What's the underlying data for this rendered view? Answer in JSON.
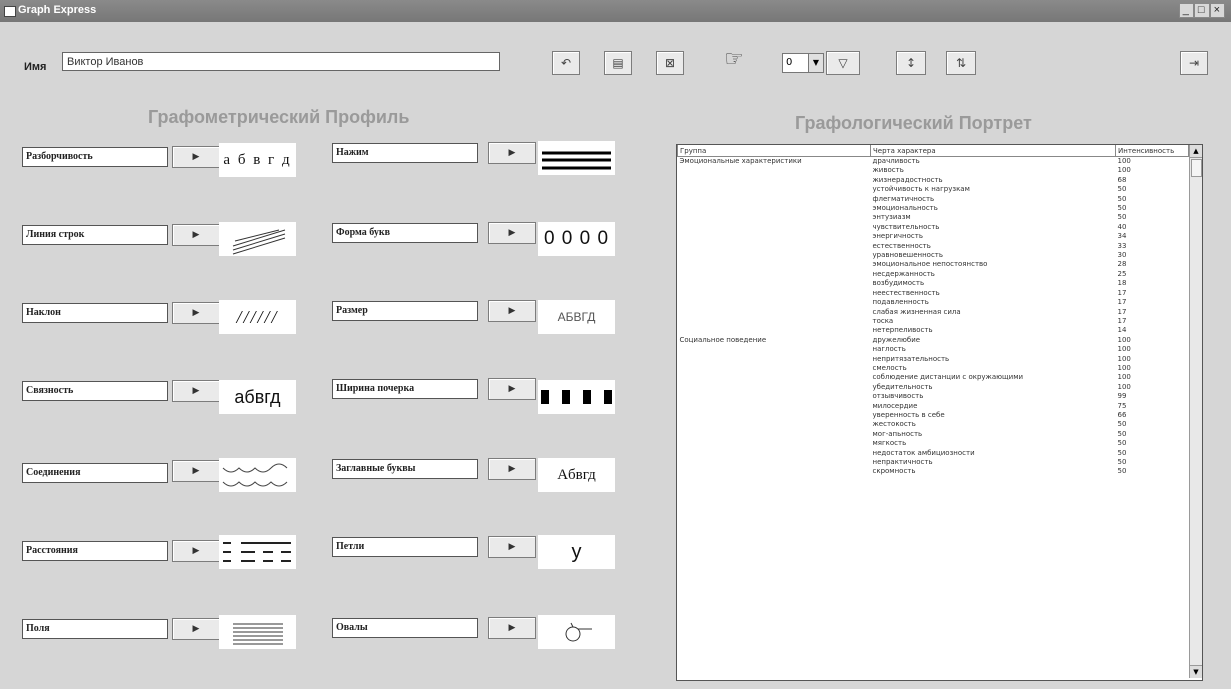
{
  "window": {
    "title": "Graph Express",
    "controls": [
      "_",
      "□",
      "×"
    ]
  },
  "name_label": "Имя",
  "name_value": "Виктор Иванов",
  "toolbar": {
    "combo_value": "0"
  },
  "left_heading": "Графометрический Профиль",
  "right_heading": "Графологический Портрет",
  "profile_items": [
    {
      "label": "Разборчивость",
      "sample": "а б в г д"
    },
    {
      "label": "Нажим",
      "sample": ""
    },
    {
      "label": "Линия строк",
      "sample": ""
    },
    {
      "label": "Форма букв",
      "sample": "0 0 0 0"
    },
    {
      "label": "Наклон",
      "sample": "//////"
    },
    {
      "label": "Размер",
      "sample": "АБВГД"
    },
    {
      "label": "Связность",
      "sample": "абвгд"
    },
    {
      "label": "Ширина почерка",
      "sample": ""
    },
    {
      "label": "Соединения",
      "sample": ""
    },
    {
      "label": "Заглавные буквы",
      "sample": "Aбвгд"
    },
    {
      "label": "Расстояния",
      "sample": ""
    },
    {
      "label": "Петли",
      "sample": "у"
    },
    {
      "label": "Поля",
      "sample": ""
    },
    {
      "label": "Овалы",
      "sample": ""
    }
  ],
  "table": {
    "headers": [
      "Группа",
      "Черта характера",
      "Интенсивность"
    ],
    "rows": [
      [
        "Эмоциональные характеристики",
        "драчливость",
        "100"
      ],
      [
        "",
        "живость",
        "100"
      ],
      [
        "",
        "жизнерадостность",
        "68"
      ],
      [
        "",
        "устойчивость к нагрузкам",
        "50"
      ],
      [
        "",
        "флегматичность",
        "50"
      ],
      [
        "",
        "эмоциональность",
        "50"
      ],
      [
        "",
        "энтузиазм",
        "50"
      ],
      [
        "",
        "чувствительность",
        "40"
      ],
      [
        "",
        "энергичность",
        "34"
      ],
      [
        "",
        "естественность",
        "33"
      ],
      [
        "",
        "уравновешенность",
        "30"
      ],
      [
        "",
        "эмоциональное непостоянство",
        "28"
      ],
      [
        "",
        "несдержанность",
        "25"
      ],
      [
        "",
        "возбудимость",
        "18"
      ],
      [
        "",
        "неестественность",
        "17"
      ],
      [
        "",
        "подавленность",
        "17"
      ],
      [
        "",
        "слабая жизненная сила",
        "17"
      ],
      [
        "",
        "тоска",
        "17"
      ],
      [
        "",
        "нетерпеливость",
        "14"
      ],
      [
        "Социальное поведение",
        "дружелюбие",
        "100"
      ],
      [
        "",
        "наглость",
        "100"
      ],
      [
        "",
        "непритязательность",
        "100"
      ],
      [
        "",
        "смелость",
        "100"
      ],
      [
        "",
        "соблюдение дистанции с окружающими",
        "100"
      ],
      [
        "",
        "убедительность",
        "100"
      ],
      [
        "",
        "отзывчивость",
        "99"
      ],
      [
        "",
        "милосердие",
        "75"
      ],
      [
        "",
        "уверенность в себе",
        "66"
      ],
      [
        "",
        "жестокость",
        "50"
      ],
      [
        "",
        "мог-апьность",
        "50"
      ],
      [
        "",
        "мягкость",
        "50"
      ],
      [
        "",
        "недостаток амбициозности",
        "50"
      ],
      [
        "",
        "непрактичность",
        "50"
      ],
      [
        "",
        "скромность",
        "50"
      ]
    ]
  }
}
